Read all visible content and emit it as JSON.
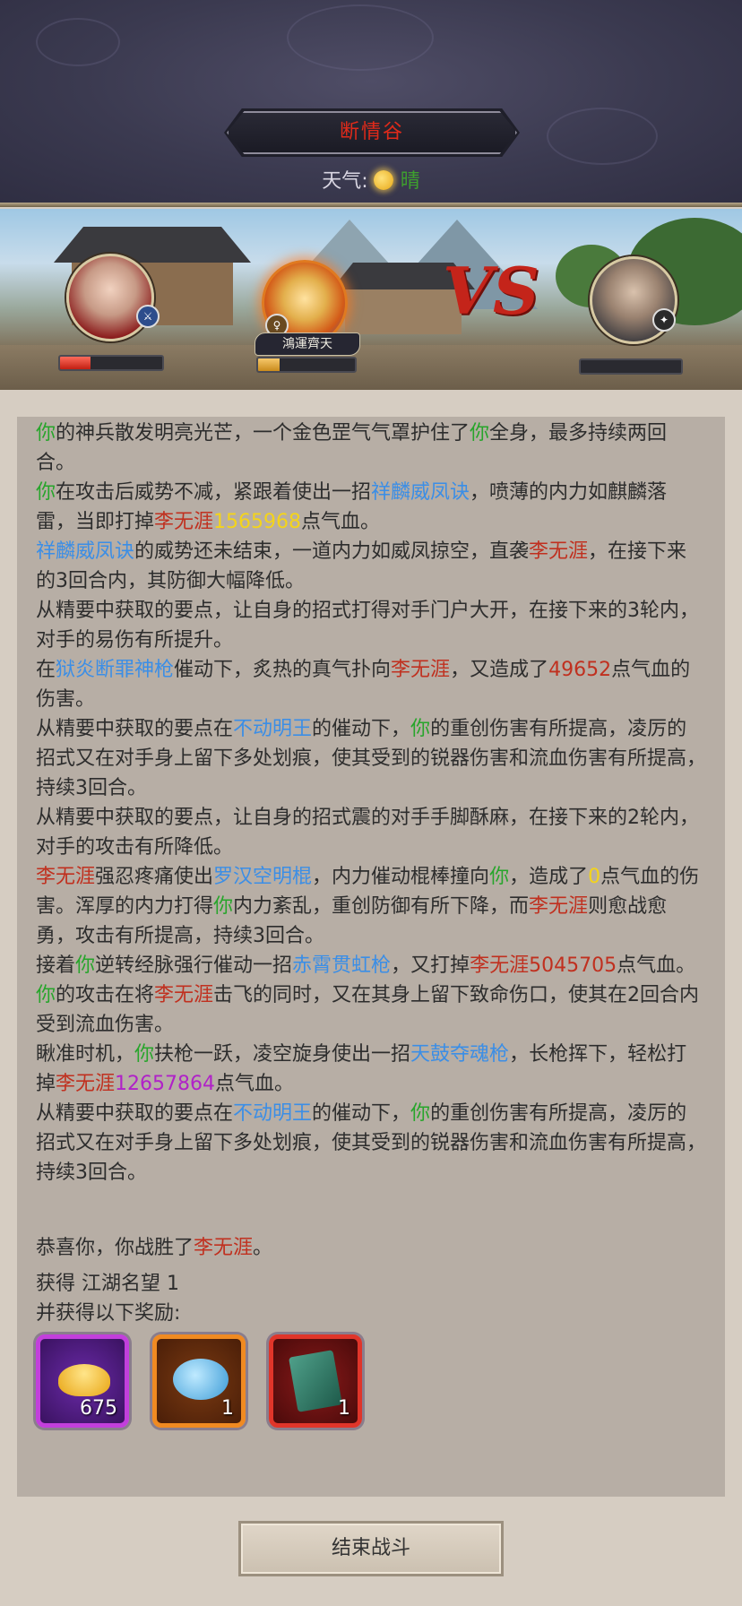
{
  "header": {
    "location": "断情谷",
    "weather_label": "天气:",
    "weather_value": "晴"
  },
  "battle": {
    "player_hp": 0.3,
    "ally_name": "鴻運齊天",
    "ally_hp": 0.22,
    "enemy_hp": 0.0,
    "vs_label": "VS"
  },
  "log": [
    [
      {
        "t": "你",
        "c": "g"
      },
      {
        "t": "的神兵散发明亮光芒，一个金色罡气气罩护住了"
      },
      {
        "t": "你",
        "c": "g"
      },
      {
        "t": "全身，最多持续两回合。"
      }
    ],
    [
      {
        "t": "你",
        "c": "g"
      },
      {
        "t": "在攻击后威势不减，紧跟着使出一招"
      },
      {
        "t": "祥麟威凤诀",
        "c": "b"
      },
      {
        "t": "，喷薄的内力如麒麟落雷，当即打掉"
      },
      {
        "t": "李无涯",
        "c": "r"
      },
      {
        "t": "1565968",
        "c": "y"
      },
      {
        "t": "点气血。"
      }
    ],
    [
      {
        "t": "祥麟威凤诀",
        "c": "b"
      },
      {
        "t": "的威势还未结束，一道内力如威凤掠空，直袭"
      },
      {
        "t": "李无涯",
        "c": "r"
      },
      {
        "t": "，在接下来的3回合内，其防御大幅降低。"
      }
    ],
    [
      {
        "t": "从精要中获取的要点，让自身的招式打得对手门户大开，在接下来的3轮内，对手的易伤有所提升。"
      }
    ],
    [
      {
        "t": "在"
      },
      {
        "t": "狱炎断罪神枪",
        "c": "b"
      },
      {
        "t": "催动下，炙热的真气扑向"
      },
      {
        "t": "李无涯",
        "c": "r"
      },
      {
        "t": "，又造成了"
      },
      {
        "t": "49652",
        "c": "r"
      },
      {
        "t": "点气血的伤害。"
      }
    ],
    [
      {
        "t": "从精要中获取的要点在"
      },
      {
        "t": "不动明王",
        "c": "b"
      },
      {
        "t": "的催动下，"
      },
      {
        "t": "你",
        "c": "g"
      },
      {
        "t": "的重创伤害有所提高，凌厉的招式又在对手身上留下多处划痕，使其受到的锐器伤害和流血伤害有所提高，持续3回合。"
      }
    ],
    [
      {
        "t": "从精要中获取的要点，让自身的招式震的对手手脚酥麻，在接下来的2轮内，对手的攻击有所降低。"
      }
    ],
    [
      {
        "t": "李无涯",
        "c": "r"
      },
      {
        "t": "强忍疼痛使出"
      },
      {
        "t": "罗汉空明棍",
        "c": "b"
      },
      {
        "t": "，内力催动棍棒撞向"
      },
      {
        "t": "你",
        "c": "g"
      },
      {
        "t": "，造成了"
      },
      {
        "t": "0",
        "c": "y"
      },
      {
        "t": "点气血的伤害。浑厚的内力打得"
      },
      {
        "t": "你",
        "c": "g"
      },
      {
        "t": "内力紊乱，重创防御有所下降，而"
      },
      {
        "t": "李无涯",
        "c": "r"
      },
      {
        "t": "则愈战愈勇，攻击有所提高，持续3回合。"
      }
    ],
    [
      {
        "t": "接着"
      },
      {
        "t": "你",
        "c": "g"
      },
      {
        "t": "逆转经脉强行催动一招"
      },
      {
        "t": "赤霄贯虹枪",
        "c": "b"
      },
      {
        "t": "，又打掉"
      },
      {
        "t": "李无涯",
        "c": "r"
      },
      {
        "t": "5045705",
        "c": "r"
      },
      {
        "t": "点气血。"
      }
    ],
    [
      {
        "t": "你",
        "c": "g"
      },
      {
        "t": "的攻击在将"
      },
      {
        "t": "李无涯",
        "c": "r"
      },
      {
        "t": "击飞的同时，又在其身上留下致命伤口，使其在2回合内受到流血伤害。"
      }
    ],
    [
      {
        "t": "瞅准时机，"
      },
      {
        "t": "你",
        "c": "g"
      },
      {
        "t": "扶枪一跃，凌空旋身使出一招"
      },
      {
        "t": "天鼓夺魂枪",
        "c": "b"
      },
      {
        "t": "，长枪挥下，轻松打掉"
      },
      {
        "t": "李无涯",
        "c": "r"
      },
      {
        "t": "12657864",
        "c": "p"
      },
      {
        "t": "点气血。"
      }
    ],
    [
      {
        "t": "从精要中获取的要点在"
      },
      {
        "t": "不动明王",
        "c": "b"
      },
      {
        "t": "的催动下，"
      },
      {
        "t": "你",
        "c": "g"
      },
      {
        "t": "的重创伤害有所提高，凌厉的招式又在对手身上留下多处划痕，使其受到的锐器伤害和流血伤害有所提高，持续3回合。"
      }
    ]
  ],
  "result": {
    "prefix": "恭喜你，你战胜了",
    "enemy": "李无涯",
    "suffix": "。"
  },
  "rewards": {
    "fame": "获得 江湖名望 1",
    "subtitle": "并获得以下奖励:",
    "items": [
      {
        "icon": "gold-ingot-icon",
        "count": "675"
      },
      {
        "icon": "blue-cloud-icon",
        "count": "1"
      },
      {
        "icon": "green-book-icon",
        "count": "1"
      }
    ]
  },
  "end_button": "结束战斗"
}
